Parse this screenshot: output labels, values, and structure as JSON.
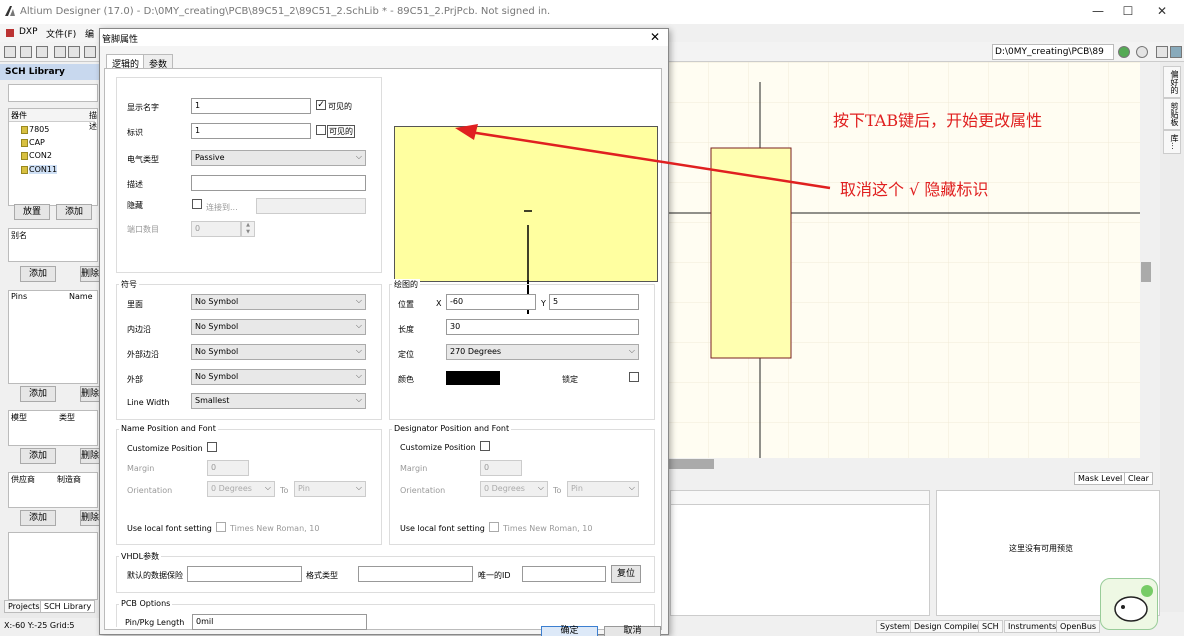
{
  "app": {
    "title": "Altium Designer (17.0) - D:\\0MY_creating\\PCB\\89C51_2\\89C51_2.SchLib * - 89C51_2.PrjPcb. Not signed in.",
    "menu": [
      "DXP",
      "文件(F)",
      "编辑"
    ],
    "path": "D:\\0MY_creating\\PCB\\89"
  },
  "left_panel": {
    "header": "SCH Library",
    "components_col1": "器件",
    "components_col2": "描述",
    "components": [
      "7805",
      "CAP",
      "CON2",
      "CON11"
    ],
    "place_btn": "放置",
    "add_btn": "添加",
    "alias_col": "别名",
    "alias_add": "添加",
    "alias_del": "删除",
    "pins_col1": "Pins",
    "pins_col2": "Name",
    "pins_add": "添加",
    "pins_del": "删除",
    "model_col1": "模型",
    "model_col2": "类型",
    "model_add": "添加",
    "model_del": "删除",
    "supplier_col1": "供应商",
    "supplier_col2": "制造商",
    "supplier_add": "添加",
    "supplier_del": "删除",
    "bottom_tabs": [
      "Projects",
      "SCH Library"
    ],
    "status": "X:-60 Y:-25   Grid:5"
  },
  "dialog": {
    "title": "管脚属性",
    "tabs": [
      "逻辑的",
      "参数"
    ],
    "display_name_label": "显示名字",
    "display_name_value": "1",
    "visible1_label": "可见的",
    "designator_label": "标识",
    "designator_value": "1",
    "visible2_label": "可见的",
    "electrical_type_label": "电气类型",
    "electrical_type_value": "Passive",
    "description_label": "描述",
    "hide_label": "隐藏",
    "connect_to_label": "连接到...",
    "part_number_label": "端口数目",
    "part_number_value": "0",
    "symbols": {
      "title": "符号",
      "inside_label": "里面",
      "inside_value": "No Symbol",
      "inside_edge_label": "内边沿",
      "inside_edge_value": "No Symbol",
      "outside_edge_label": "外部边沿",
      "outside_edge_value": "No Symbol",
      "outside_label": "外部",
      "outside_value": "No Symbol",
      "line_width_label": "Line Width",
      "line_width_value": "Smallest"
    },
    "graphical": {
      "title": "绘图的",
      "location_label": "位置",
      "x_label": "X",
      "x_value": "-60",
      "y_label": "Y",
      "y_value": "5",
      "length_label": "长度",
      "length_value": "30",
      "orientation_label": "定位",
      "orientation_value": "270 Degrees",
      "color_label": "颜色",
      "color_value": "#000000",
      "locked_label": "锁定"
    },
    "name_font": {
      "title": "Name Position and Font",
      "customize_label": "Customize Position",
      "margin_label": "Margin",
      "margin_value": "0",
      "orientation_label": "Orientation",
      "orientation_value": "0 Degrees",
      "to_label": "To",
      "to_value": "Pin",
      "use_local_label": "Use local font setting",
      "font_value": "Times New Roman, 10"
    },
    "designator_font": {
      "title": "Designator Position and Font",
      "customize_label": "Customize Position",
      "margin_label": "Margin",
      "margin_value": "0",
      "orientation_label": "Orientation",
      "orientation_value": "0 Degrees",
      "to_label": "To",
      "to_value": "Pin",
      "use_local_label": "Use local font setting",
      "font_value": "Times New Roman, 10"
    },
    "vhdl": {
      "title": "VHDL参数",
      "default_value_label": "默认的数据保险",
      "format_type_label": "格式类型",
      "unique_id_label": "唯一的ID",
      "reset_btn": "复位"
    },
    "pcb": {
      "title": "PCB Options",
      "pkg_length_label": "Pin/Pkg Length",
      "pkg_length_value": "0mil"
    },
    "ok_btn": "确定",
    "cancel_btn": "取消"
  },
  "annotations": {
    "tab_hint": "按下TAB键后，开始更改属性",
    "uncheck_hint": "取消这个 √ 隐藏标识"
  },
  "right_strip_tabs": [
    "偏好的",
    "剪贴板",
    "库..."
  ],
  "lower": {
    "mask_level": "Mask Level",
    "clear": "Clear",
    "no_preview": "这里没有可用预览"
  },
  "status_tabs": [
    "System",
    "Design Compiler",
    "SCH",
    "Instruments",
    "OpenBus"
  ],
  "colors": {
    "preview_fill": "#ffffa0",
    "canvas_bg": "#fffdf2",
    "body_fill": "#ffffb0",
    "annotation": "#e02020",
    "pin_color": "#000000"
  }
}
